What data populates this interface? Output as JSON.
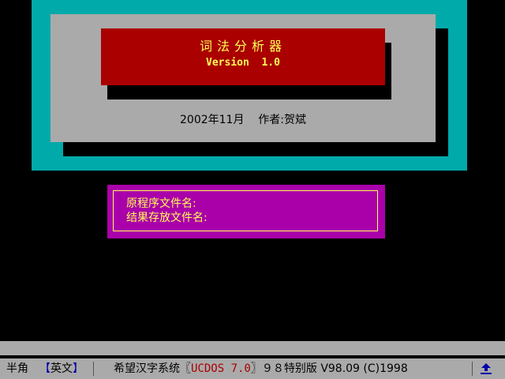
{
  "splash": {
    "title": "词法分析器",
    "version": "Version  1.0",
    "credit": "2002年11月    作者:贺斌"
  },
  "dialog": {
    "source_label": "原程序文件名:",
    "result_label": "结果存放文件名:"
  },
  "status_bar": {
    "input_width": "半角",
    "input_mode_bracket_open": "【",
    "input_mode": "英文",
    "input_mode_bracket_close": "】",
    "system_name": "希望汉字系统",
    "bracket_open": "〖",
    "product": "UCDOS 7.0",
    "bracket_close": "〗",
    "edition": "９８特别版",
    "build": "V98.09 (C)1998",
    "ime_icon": "ime-toggle-icon"
  },
  "colors": {
    "background": "#000000",
    "frame": "#00AAAA",
    "panel": "#AAAAAA",
    "title_box": "#AA0000",
    "title_text": "#FFFF55",
    "dialog": "#AA00AA",
    "status_accent": "#0000AA"
  }
}
